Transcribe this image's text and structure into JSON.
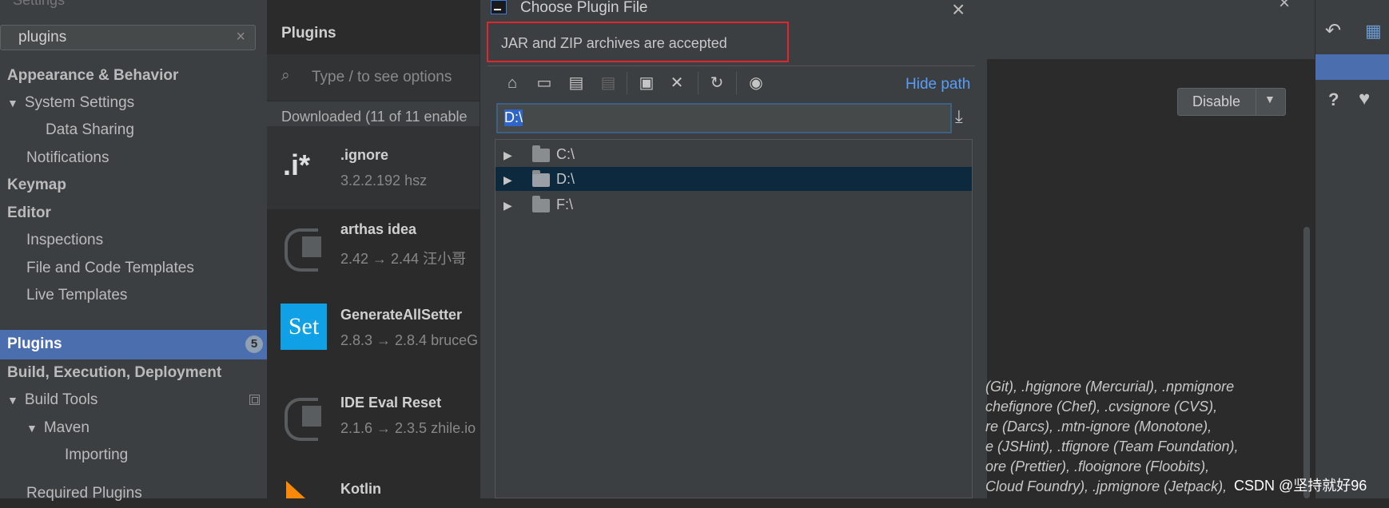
{
  "settings": {
    "window_title": "Settings",
    "search_value": "plugins",
    "tree": [
      {
        "label": "Appearance & Behavior"
      },
      {
        "label": "System Settings"
      },
      {
        "label": "Data Sharing"
      },
      {
        "label": "Notifications"
      },
      {
        "label": "Keymap"
      },
      {
        "label": "Editor"
      },
      {
        "label": "Inspections"
      },
      {
        "label": "File and Code Templates"
      },
      {
        "label": "Live Templates"
      },
      {
        "label": "Plugins",
        "badge": "5"
      },
      {
        "label": "Build, Execution, Deployment"
      },
      {
        "label": "Build Tools"
      },
      {
        "label": "Maven"
      },
      {
        "label": "Importing"
      },
      {
        "label": "Required Plugins"
      }
    ]
  },
  "plugins": {
    "header": "Plugins",
    "search_placeholder": "Type / to see options",
    "downloaded_label": "Downloaded (11 of 11 enable",
    "items": [
      {
        "name": ".ignore",
        "version": "3.2.2.192  hsz",
        "icon": ".i*"
      },
      {
        "name": "arthas idea",
        "version": "2.42 → 2.44  汪小哥",
        "icon": "plug-icon"
      },
      {
        "name": "GenerateAllSetter",
        "version": "2.8.3 → 2.8.4  bruceG",
        "icon": "Set"
      },
      {
        "name": "IDE Eval Reset",
        "version": "2.1.6 → 2.3.5  zhile.io",
        "icon": "plug-icon"
      },
      {
        "name": "Kotlin",
        "version": "",
        "icon": "kotlin-icon"
      }
    ]
  },
  "dialog": {
    "title": "Choose Plugin File",
    "hint": "JAR and ZIP archives are accepted",
    "hide_path": "Hide path",
    "path_value": "D:\\",
    "files": [
      {
        "label": "C:\\"
      },
      {
        "label": "D:\\"
      },
      {
        "label": "F:\\"
      }
    ]
  },
  "detail": {
    "disable_label": "Disable",
    "description_lines": [
      "(Git), .hgignore (Mercurial), .npmignore",
      "chefignore (Chef), .cvsignore (CVS),",
      "re (Darcs), .mtn-ignore (Monotone),",
      "e (JSHint), .tfignore (Team Foundation),",
      "ore (Prettier), .flooignore (Floobits),",
      "Cloud Foundry), .jpmignore (Jetpack),"
    ]
  },
  "watermark": "CSDN @坚持就好96",
  "colors": {
    "accent": "#4b6eaf",
    "highlight_border": "#e0262d",
    "link": "#589df6",
    "selection": "#0d293e"
  }
}
